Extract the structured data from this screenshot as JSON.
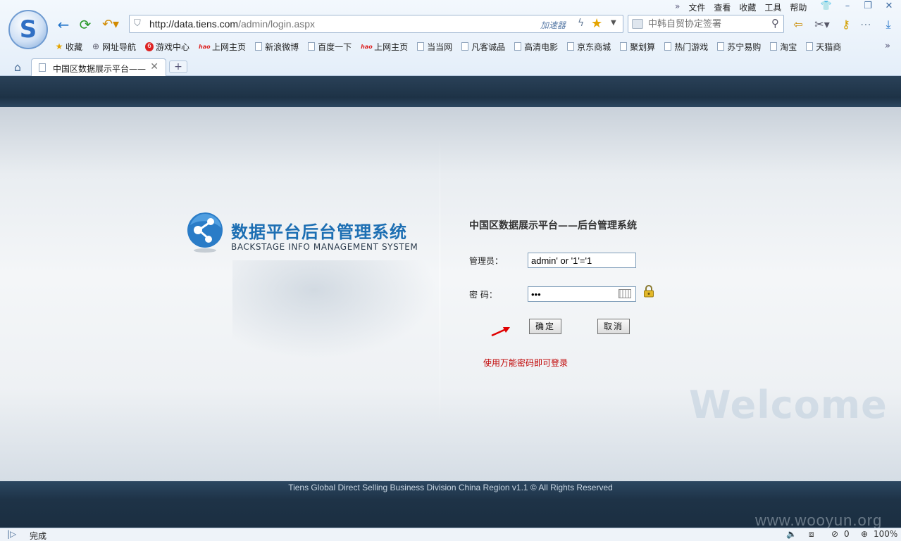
{
  "browser": {
    "menu": [
      "文件",
      "查看",
      "收藏",
      "工具",
      "帮助"
    ],
    "address": {
      "url_host": "http://data.tiens.com",
      "url_path": "/admin/login.aspx",
      "accelerator": "加速器"
    },
    "search": {
      "placeholder": "中韩自贸协定签署"
    },
    "bookmarks": [
      {
        "label": "收藏",
        "icon": "star-icon"
      },
      {
        "label": "网址导航",
        "icon": "globe-icon"
      },
      {
        "label": "游戏中心",
        "icon": "game-icon"
      },
      {
        "label": "上网主页",
        "icon": "hao-icon"
      },
      {
        "label": "新浪微博",
        "icon": "page-icon"
      },
      {
        "label": "百度一下",
        "icon": "page-icon"
      },
      {
        "label": "上网主页",
        "icon": "hao-icon"
      },
      {
        "label": "当当网",
        "icon": "page-icon"
      },
      {
        "label": "凡客诚品",
        "icon": "page-icon"
      },
      {
        "label": "高清电影",
        "icon": "page-icon"
      },
      {
        "label": "京东商城",
        "icon": "page-icon"
      },
      {
        "label": "聚划算",
        "icon": "page-icon"
      },
      {
        "label": "热门游戏",
        "icon": "page-icon"
      },
      {
        "label": "苏宁易购",
        "icon": "page-icon"
      },
      {
        "label": "淘宝",
        "icon": "page-icon"
      },
      {
        "label": "天猫商",
        "icon": "page-icon"
      }
    ],
    "tab": {
      "title": "中国区数据展示平台——"
    },
    "status": {
      "text": "完成",
      "count": "0",
      "zoom": "100%"
    }
  },
  "page": {
    "system_title_cn": "数据平台后台管理系统",
    "system_title_en": "BACKSTAGE INFO MANAGEMENT SYSTEM",
    "form_title": "中国区数据展示平台——后台管理系统",
    "admin_label": "管理员：",
    "admin_value": "admin' or '1'='1",
    "password_label": "密 码：",
    "password_value": "•••",
    "confirm_label": "确定",
    "cancel_label": "取消",
    "hint": "使用万能密码即可登录",
    "welcome": "Welcome",
    "footer": "Tiens Global Direct Selling Business Division China Region v1.1 © All Rights Reserved",
    "watermark": "www.wooyun.org"
  },
  "colors": {
    "accent": "#1d6fb3",
    "hint": "#c00000",
    "band": "#1d3246"
  }
}
